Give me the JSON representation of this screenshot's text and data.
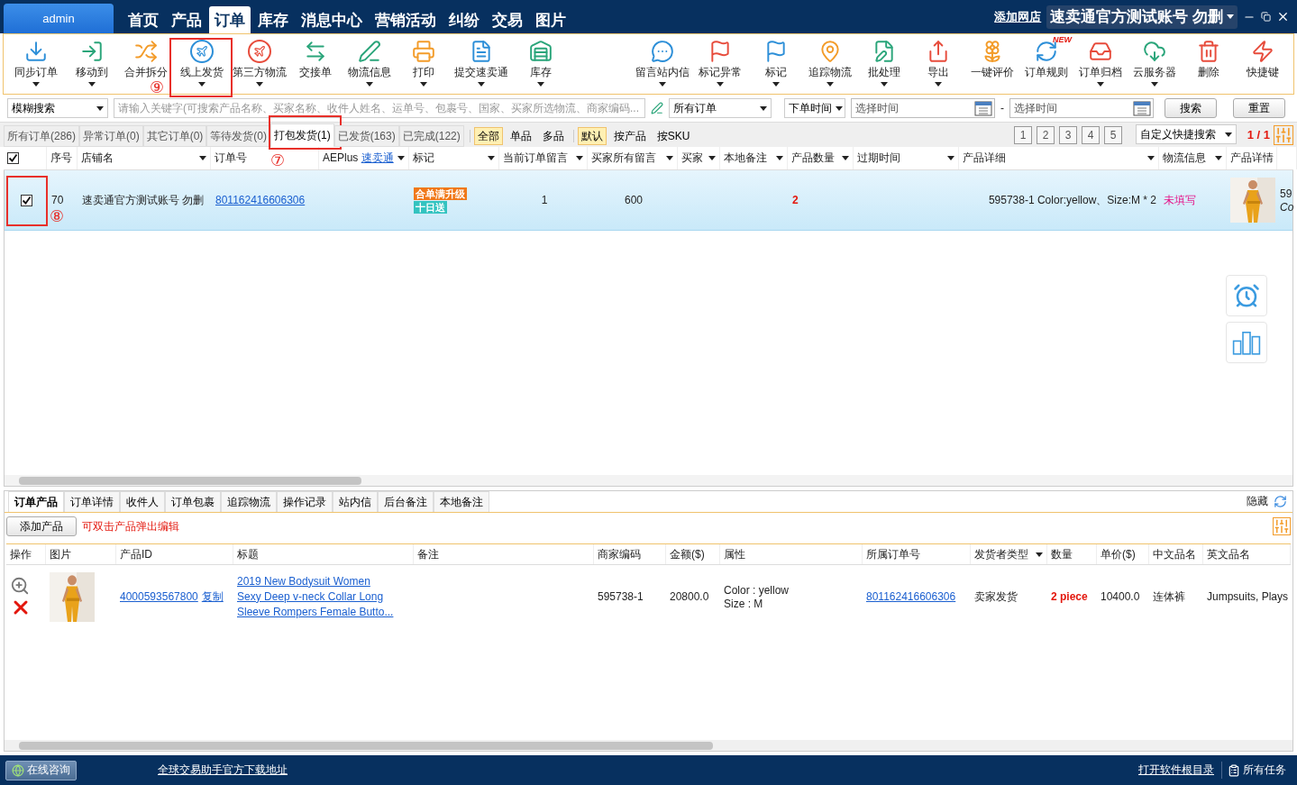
{
  "window": {
    "user": "admin",
    "menu": [
      {
        "label": "首页",
        "selected": false
      },
      {
        "label": "产品",
        "selected": false
      },
      {
        "label": "订单",
        "selected": true
      },
      {
        "label": "库存",
        "selected": false
      },
      {
        "label": "消息中心",
        "selected": false
      },
      {
        "label": "营销活动",
        "selected": false
      },
      {
        "label": "纠纷",
        "selected": false
      },
      {
        "label": "交易",
        "selected": false
      },
      {
        "label": "图片",
        "selected": false
      }
    ],
    "add_store": "添加网店",
    "account": "速卖通官方测试账号 勿删"
  },
  "toolbar": {
    "left": [
      {
        "label": "同步订单",
        "has_menu": true
      },
      {
        "label": "移动到",
        "has_menu": true
      },
      {
        "label": "合并拆分",
        "has_menu": false
      },
      {
        "label": "线上发货",
        "has_menu": true,
        "callout": "⑨"
      },
      {
        "label": "第三方物流",
        "has_menu": true
      },
      {
        "label": "交接单",
        "has_menu": false
      },
      {
        "label": "物流信息",
        "has_menu": true
      },
      {
        "label": "打印",
        "has_menu": true
      },
      {
        "label": "提交速卖通",
        "has_menu": true
      },
      {
        "label": "库存",
        "has_menu": true
      }
    ],
    "right": [
      {
        "label": "留言站内信",
        "has_menu": true
      },
      {
        "label": "标记异常",
        "has_menu": true
      },
      {
        "label": "标记",
        "has_menu": true
      },
      {
        "label": "追踪物流",
        "has_menu": true
      },
      {
        "label": "批处理",
        "has_menu": true
      },
      {
        "label": "导出",
        "has_menu": true
      },
      {
        "label": "一键评价",
        "has_menu": false
      },
      {
        "label": "订单规则",
        "has_menu": false,
        "badge": "NEW"
      },
      {
        "label": "订单归档",
        "has_menu": true
      },
      {
        "label": "云服务器",
        "has_menu": true
      },
      {
        "label": "删除",
        "has_menu": false
      },
      {
        "label": "快捷键",
        "has_menu": false
      }
    ]
  },
  "search": {
    "mode": "模糊搜索",
    "placeholder": "请输入关键字(可搜索产品名称、买家名称、收件人姓名、运单号、包裹号、国家、买家所选物流、商家编码...",
    "order_filter": "所有订单",
    "time_type": "下单时间",
    "date_from": "选择时间",
    "separator": "-",
    "date_to": "选择时间",
    "buttons": [
      "搜索",
      "重置"
    ]
  },
  "status_tabs": [
    {
      "label": "所有订单(286)",
      "selected": false
    },
    {
      "label": "异常订单(0)",
      "selected": false
    },
    {
      "label": "其它订单(0)",
      "selected": false
    },
    {
      "label": "等待发货(0)",
      "selected": false
    },
    {
      "label": "打包发货(1)",
      "selected": true,
      "callout": "⑦"
    },
    {
      "label": "已发货(163)",
      "selected": false
    },
    {
      "label": "已完成(122)",
      "selected": false
    }
  ],
  "filters": [
    [
      {
        "label": "全部",
        "selected": true
      },
      {
        "label": "单品",
        "selected": false
      },
      {
        "label": "多品",
        "selected": false
      }
    ],
    [
      {
        "label": "默认",
        "selected": true
      },
      {
        "label": "按产品",
        "selected": false
      },
      {
        "label": "按SKU",
        "selected": false
      }
    ]
  ],
  "pages": [
    "1",
    "2",
    "3",
    "4",
    "5"
  ],
  "quick_search": "自定义快捷搜索",
  "page_count": "1 / 1",
  "orders": {
    "all_checked": true,
    "columns": [
      {
        "label": "序号",
        "filter": false
      },
      {
        "label": "店铺名",
        "filter": true
      },
      {
        "label": "订单号",
        "filter": false
      },
      {
        "label": "AEPlus",
        "link": "速卖通",
        "filter": true
      },
      {
        "label": "标记",
        "filter": true
      },
      {
        "label": "当前订单留言",
        "filter": true
      },
      {
        "label": "买家所有留言",
        "filter": true
      },
      {
        "label": "买家",
        "filter": true
      },
      {
        "label": "本地备注",
        "filter": true
      },
      {
        "label": "产品数量",
        "filter": true
      },
      {
        "label": "过期时间",
        "filter": true
      },
      {
        "label": "产品详细",
        "filter": true
      },
      {
        "label": "物流信息",
        "filter": true
      },
      {
        "label": "产品详情",
        "filter": false
      }
    ],
    "rows": [
      {
        "checked": true,
        "selected": true,
        "callout": "⑧",
        "index": "70",
        "store": "速卖通官方测试账号 勿删",
        "order_no": "801162416606306",
        "tags": [
          {
            "label": "合单满升级",
            "color": "#f07818"
          },
          {
            "label": "十日送",
            "color": "#33c3c0"
          }
        ],
        "current_message": "1",
        "all_messages": "600",
        "quantity": "2",
        "product_detail": "595738-1  Color:yellow、Size:M * 2",
        "logistics": "未填写",
        "image": {
          "kind": "picture"
        },
        "column_16": [
          "59",
          "Co"
        ]
      }
    ]
  },
  "detail_tabs": [
    {
      "label": "订单产品",
      "selected": true
    },
    {
      "label": "订单详情",
      "selected": false
    },
    {
      "label": "收件人",
      "selected": false
    },
    {
      "label": "订单包裹",
      "selected": false
    },
    {
      "label": "追踪物流",
      "selected": false
    },
    {
      "label": "操作记录",
      "selected": false
    },
    {
      "label": "站内信",
      "selected": false
    },
    {
      "label": "后台备注",
      "selected": false
    },
    {
      "label": "本地备注",
      "selected": false
    }
  ],
  "hide": "隐藏",
  "add_product": "添加产品",
  "hint": "可双击产品弹出编辑",
  "products": {
    "columns": [
      "操作",
      "图片",
      "产品ID",
      "标题",
      "备注",
      "商家编码",
      "金额($)",
      "属性",
      "所属订单号",
      "发货者类型",
      "数量",
      "单价($)",
      "中文品名",
      "英文品名"
    ],
    "rows": [
      {
        "image": {
          "kind": "picture"
        },
        "product_id": "4000593567800",
        "copy": "复制",
        "title": [
          "2019 New Bodysuit Women",
          "Sexy Deep v-neck Collar Long",
          "Sleeve Rompers Female Butto..."
        ],
        "sku": "595738-1",
        "amount": "20800.0",
        "attributes": [
          "Color : yellow",
          "Size : M"
        ],
        "order_no": "801162416606306",
        "seller_type": "卖家发货",
        "quantity": "2 piece",
        "unit_price": "10400.0",
        "cn_name": "连体裤",
        "en_name": "Jumpsuits, Plays"
      }
    ]
  },
  "status_bar": {
    "consult": "在线咨询",
    "download_link": "全球交易助手官方下载地址",
    "open_dir": "打开软件根目录",
    "tasks": "所有任务"
  }
}
